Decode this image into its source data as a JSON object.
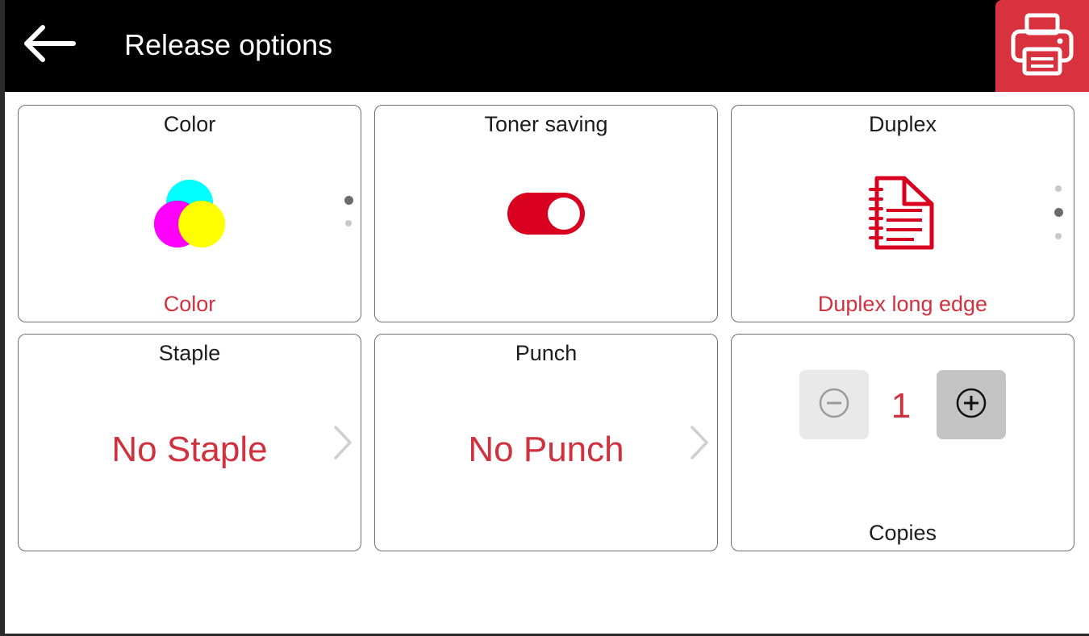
{
  "header": {
    "title": "Release options",
    "back_icon": "arrow-left-icon",
    "print_icon": "printer-icon"
  },
  "colors": {
    "accent_red": "#d0313e",
    "header_bg": "#000000",
    "toggle_on": "#d8001e"
  },
  "cards": {
    "color": {
      "title": "Color",
      "value": "Color",
      "icon": "cmyk-color-circles-icon"
    },
    "toner": {
      "title": "Toner saving",
      "state": "on"
    },
    "duplex": {
      "title": "Duplex",
      "value": "Duplex long edge",
      "icon": "duplex-document-icon"
    },
    "staple": {
      "title": "Staple",
      "value": "No Staple"
    },
    "punch": {
      "title": "Punch",
      "value": "No Punch"
    },
    "copies": {
      "label": "Copies",
      "value": "1"
    }
  }
}
